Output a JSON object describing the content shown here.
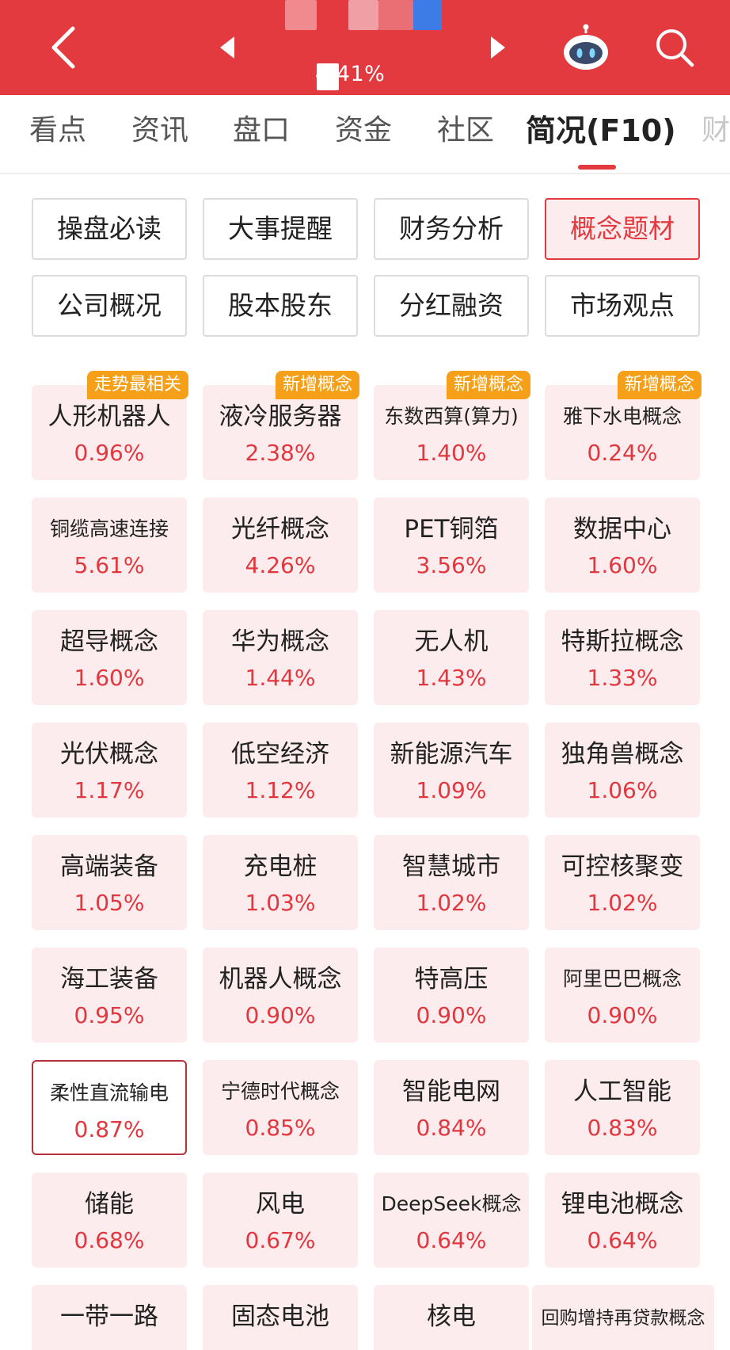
{
  "header": {
    "change_text": "4.41%",
    "back_icon": "chevron-left-icon",
    "prev_icon": "triangle-left-icon",
    "next_icon": "triangle-right-icon",
    "assistant_icon": "robot-icon",
    "search_icon": "search-icon",
    "colors": {
      "bar": "#e33a3f",
      "text": "#ffffff"
    }
  },
  "tabs": [
    {
      "label": "看点"
    },
    {
      "label": "资讯"
    },
    {
      "label": "盘口"
    },
    {
      "label": "资金"
    },
    {
      "label": "社区"
    },
    {
      "label": "简况(F10)",
      "active": true
    },
    {
      "label": "财"
    }
  ],
  "subnav": [
    {
      "label": "操盘必读"
    },
    {
      "label": "大事提醒"
    },
    {
      "label": "财务分析"
    },
    {
      "label": "概念题材",
      "active": true
    },
    {
      "label": "公司概况"
    },
    {
      "label": "股本股东"
    },
    {
      "label": "分红融资"
    },
    {
      "label": "市场观点"
    }
  ],
  "concepts": [
    {
      "name": "人形机器人",
      "pct": "0.96%",
      "badge": "走势最相关"
    },
    {
      "name": "液冷服务器",
      "pct": "2.38%",
      "badge": "新增概念"
    },
    {
      "name": "东数西算(算力)",
      "pct": "1.40%",
      "badge": "新增概念"
    },
    {
      "name": "雅下水电概念",
      "pct": "0.24%",
      "badge": "新增概念"
    },
    {
      "name": "铜缆高速连接",
      "pct": "5.61%"
    },
    {
      "name": "光纤概念",
      "pct": "4.26%"
    },
    {
      "name": "PET铜箔",
      "pct": "3.56%"
    },
    {
      "name": "数据中心",
      "pct": "1.60%"
    },
    {
      "name": "超导概念",
      "pct": "1.60%"
    },
    {
      "name": "华为概念",
      "pct": "1.44%"
    },
    {
      "name": "无人机",
      "pct": "1.43%"
    },
    {
      "name": "特斯拉概念",
      "pct": "1.33%"
    },
    {
      "name": "光伏概念",
      "pct": "1.17%"
    },
    {
      "name": "低空经济",
      "pct": "1.12%"
    },
    {
      "name": "新能源汽车",
      "pct": "1.09%"
    },
    {
      "name": "独角兽概念",
      "pct": "1.06%"
    },
    {
      "name": "高端装备",
      "pct": "1.05%"
    },
    {
      "name": "充电桩",
      "pct": "1.03%"
    },
    {
      "name": "智慧城市",
      "pct": "1.02%"
    },
    {
      "name": "可控核聚变",
      "pct": "1.02%"
    },
    {
      "name": "海工装备",
      "pct": "0.95%"
    },
    {
      "name": "机器人概念",
      "pct": "0.90%"
    },
    {
      "name": "特高压",
      "pct": "0.90%"
    },
    {
      "name": "阿里巴巴概念",
      "pct": "0.90%"
    },
    {
      "name": "柔性直流输电",
      "pct": "0.87%",
      "outlined": true
    },
    {
      "name": "宁德时代概念",
      "pct": "0.85%"
    },
    {
      "name": "智能电网",
      "pct": "0.84%"
    },
    {
      "name": "人工智能",
      "pct": "0.83%"
    },
    {
      "name": "储能",
      "pct": "0.68%"
    },
    {
      "name": "风电",
      "pct": "0.67%"
    },
    {
      "name": "DeepSeek概念",
      "pct": "0.64%"
    },
    {
      "name": "锂电池概念",
      "pct": "0.64%"
    },
    {
      "name": "一带一路",
      "pct": ""
    },
    {
      "name": "固态电池",
      "pct": ""
    },
    {
      "name": "核电",
      "pct": ""
    },
    {
      "name": "回购增持再贷款概念",
      "pct": ""
    }
  ],
  "colors": {
    "accent": "#e33a3f",
    "tile_bg": "#fdecee",
    "percent_up": "#e0383e",
    "badge": "#f6a01a"
  }
}
